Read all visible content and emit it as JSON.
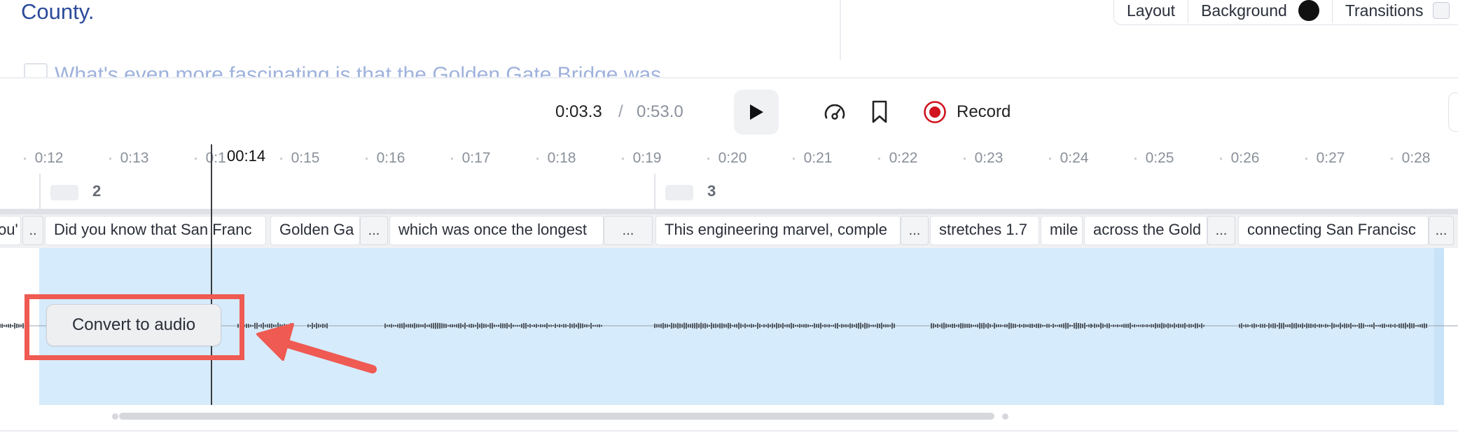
{
  "editor": {
    "county_text": "County.",
    "faded_line_text": "What's even more fascinating is that the Golden Gate Bridge was"
  },
  "toolbar": {
    "layout_label": "Layout",
    "background_label": "Background",
    "transitions_label": "Transitions",
    "background_color": "#111111"
  },
  "player": {
    "current_time": "0:03.3",
    "separator": "/",
    "total_time": "0:53.0",
    "record_label": "Record",
    "record_color": "#d0131e"
  },
  "ruler": {
    "ticks": [
      "0:12",
      "0:13",
      "0:14",
      "0:15",
      "0:16",
      "0:17",
      "0:18",
      "0:19",
      "0:20",
      "0:21",
      "0:22",
      "0:23",
      "0:24",
      "0:25",
      "0:26",
      "0:27",
      "0:28"
    ],
    "playhead_label": "00:14"
  },
  "scenes": [
    {
      "number": "2"
    },
    {
      "number": "3"
    }
  ],
  "clips": [
    {
      "text": "ou'"
    },
    {
      "text": "Did you know that San Franc"
    },
    {
      "text": "Golden Ga"
    },
    {
      "text": "which was once the longest"
    },
    {
      "text": "This engineering marvel, comple"
    },
    {
      "text": "stretches 1.7"
    },
    {
      "text": "mile"
    },
    {
      "text": "across the Gold"
    },
    {
      "text": "connecting San Francisc"
    }
  ],
  "more_short": "..",
  "more_label": "...",
  "audio": {
    "convert_label": "Convert to audio",
    "region_color": "#d6ebfb"
  },
  "annotation": {
    "highlight_color": "#ef5a52"
  }
}
